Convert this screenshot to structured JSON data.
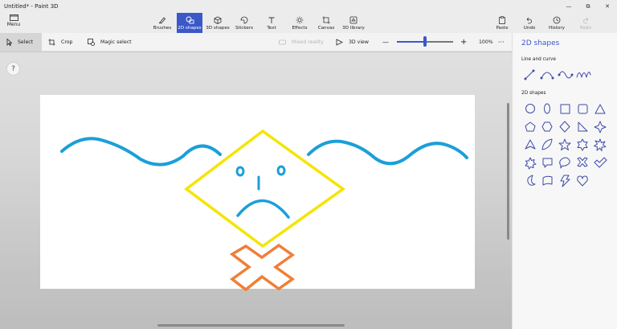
{
  "window": {
    "title": "Untitled* - Paint 3D",
    "controls": [
      "—",
      "⧉",
      "✕"
    ]
  },
  "ribbon": {
    "menu_label": "Menu",
    "tools": [
      {
        "label": "Brushes"
      },
      {
        "label": "2D shapes"
      },
      {
        "label": "3D shapes"
      },
      {
        "label": "Stickers"
      },
      {
        "label": "Text"
      },
      {
        "label": "Effects"
      },
      {
        "label": "Canvas"
      },
      {
        "label": "3D library"
      }
    ],
    "right_tools": [
      {
        "label": "Paste"
      },
      {
        "label": "Undo"
      },
      {
        "label": "History"
      },
      {
        "label": "Redo"
      }
    ],
    "active_tool": "2D shapes",
    "accent_color": "#3b58c8"
  },
  "toolbar": {
    "select_label": "Select",
    "crop_label": "Crop",
    "magic_select_label": "Magic select",
    "mixed_reality_label": "Mixed reality",
    "view_3d_label": "3D view",
    "zoom_minus": "—",
    "zoom_plus": "+",
    "zoom_level": "100%",
    "zoom_fraction": 0.51,
    "more_label": "···"
  },
  "workspace": {
    "help_label": "?",
    "canvas_background": "#ffffff",
    "drawing_colors": {
      "waves": "#1b9fd9",
      "diamond": "#f5e400",
      "face": "#1b9fd9",
      "cross": "#f07f36"
    }
  },
  "panel": {
    "title": "2D shapes",
    "line_section_title": "Line and curve",
    "line_shapes": [
      "line-icon",
      "curve-icon",
      "s-curve-icon",
      "zigzag-curve-icon"
    ],
    "shape_section_title": "2D shapes",
    "shapes": [
      "circle-icon",
      "oval-icon",
      "square-icon",
      "rounded-square-icon",
      "triangle-icon",
      "pentagon-icon",
      "hexagon-icon",
      "diamond-icon",
      "right-triangle-icon",
      "star4-icon",
      "arrow-up-icon",
      "leaf-icon",
      "star5-icon",
      "star6-icon",
      "burst-icon",
      "burst-alt-icon",
      "speech-bubble-icon",
      "thought-bubble-icon",
      "cross-x-icon",
      "checkmark-icon",
      "moon-icon",
      "wave-flag-icon",
      "lightning-icon",
      "heart-icon"
    ],
    "icon_color": "#3d4aa8"
  }
}
